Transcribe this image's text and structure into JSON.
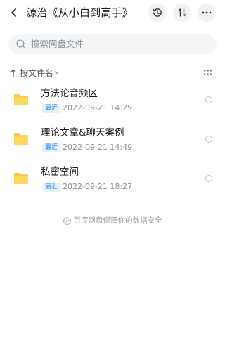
{
  "header": {
    "title": "源治《从小白到高手》",
    "icons": {
      "back": "chevron-left-icon",
      "history": "history-icon",
      "sort": "sort-arrows-icon",
      "more": "more-dots-icon"
    }
  },
  "search": {
    "placeholder": "搜索网盘文件",
    "icon": "search-icon"
  },
  "sort": {
    "label": "按文件名",
    "icon": "sort-up-arrow-icon",
    "view_icon": "grid-view-icon"
  },
  "files": [
    {
      "name": "方法论音频区",
      "badge": "最近",
      "date": "2022-09-21  14:29",
      "icon": "folder-icon"
    },
    {
      "name": "理论文章&聊天案例",
      "badge": "最近",
      "date": "2022-09-21  14:49",
      "icon": "folder-icon"
    },
    {
      "name": "私密空间",
      "badge": "最近",
      "date": "2022-09-21  18:27",
      "icon": "folder-icon"
    }
  ],
  "footer": {
    "text": "百度网盘保障你的数据安全",
    "icon": "shield-icon"
  },
  "colors": {
    "folder": "#f7c948",
    "accent": "#2f7ff5",
    "badge_bg": "#e6f1fe",
    "search_bg": "#f4f5f7"
  }
}
